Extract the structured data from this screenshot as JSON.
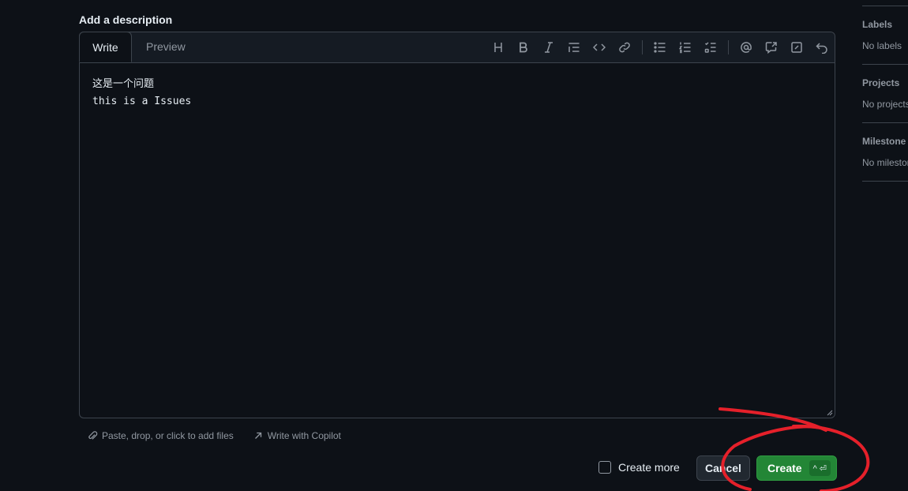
{
  "description": {
    "title": "Add a description",
    "tabs": {
      "write": "Write",
      "preview": "Preview"
    },
    "toolbar": [
      {
        "icon": "heading-icon"
      },
      {
        "icon": "bold-icon"
      },
      {
        "icon": "italic-icon"
      },
      {
        "icon": "quote-icon"
      },
      {
        "icon": "code-icon"
      },
      {
        "icon": "link-icon"
      },
      {
        "icon": "unordered-list-icon"
      },
      {
        "icon": "ordered-list-icon"
      },
      {
        "icon": "task-list-icon"
      },
      {
        "icon": "mention-icon"
      },
      {
        "icon": "cross-reference-icon"
      },
      {
        "icon": "saved-replies-icon"
      },
      {
        "icon": "undo-icon"
      }
    ],
    "text_lines": [
      "这是一个问题",
      "this is a Issues"
    ]
  },
  "footer": {
    "attach_label": "Paste, drop, or click to add files",
    "copilot_label": "Write with Copilot"
  },
  "actions": {
    "create_more_label": "Create more",
    "create_more_checked": false,
    "cancel_label": "Cancel",
    "create_label": "Create",
    "create_shortcut": "^ ⏎"
  },
  "sidebar": {
    "labels_title": "Labels",
    "labels_value": "No labels",
    "projects_title": "Projects",
    "projects_value": "No projects",
    "milestone_title": "Milestone",
    "milestone_value": "No milestone"
  },
  "colors": {
    "background": "#0d1117",
    "primary_button": "#238636",
    "annotation": "#e5202a"
  }
}
